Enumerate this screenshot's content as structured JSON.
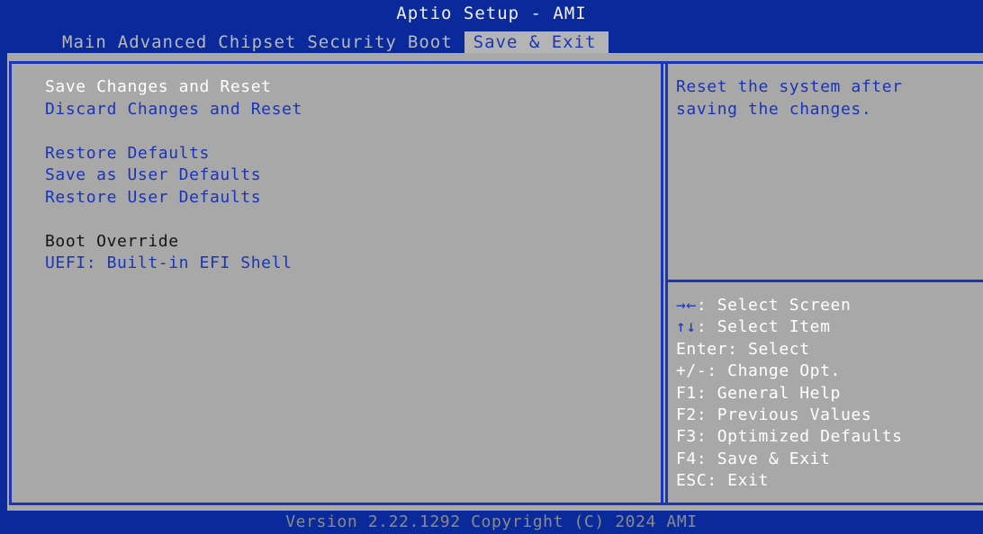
{
  "title": "Aptio Setup - AMI",
  "tabs": [
    {
      "label": "Main"
    },
    {
      "label": "Advanced"
    },
    {
      "label": "Chipset"
    },
    {
      "label": "Security"
    },
    {
      "label": "Boot"
    },
    {
      "label": "Save & Exit",
      "active": true
    }
  ],
  "menu": {
    "save_changes_reset": "Save Changes and Reset",
    "discard_changes_reset": "Discard Changes and Reset",
    "restore_defaults": "Restore Defaults",
    "save_user_defaults": "Save as User Defaults",
    "restore_user_defaults": "Restore User Defaults",
    "boot_override_label": "Boot Override",
    "uefi_shell": "UEFI: Built-in EFI Shell"
  },
  "help": {
    "line1": "Reset the system after",
    "line2": "saving the changes."
  },
  "keys": [
    {
      "key": "→←",
      "desc": ": Select Screen"
    },
    {
      "key": "↑↓",
      "desc": ": Select Item"
    },
    {
      "key": "",
      "desc": "Enter: Select"
    },
    {
      "key": "",
      "desc": "+/-: Change Opt."
    },
    {
      "key": "",
      "desc": "F1: General Help"
    },
    {
      "key": "",
      "desc": "F2: Previous Values"
    },
    {
      "key": "",
      "desc": "F3: Optimized Defaults"
    },
    {
      "key": "",
      "desc": "F4: Save & Exit"
    },
    {
      "key": "",
      "desc": "ESC: Exit"
    }
  ],
  "footer": "Version 2.22.1292 Copyright (C) 2024 AMI",
  "colors": {
    "background": "#0a2a9b",
    "panel": "#a8a8a8",
    "accent": "#1a35b8",
    "highlight_text": "#ffffff"
  }
}
